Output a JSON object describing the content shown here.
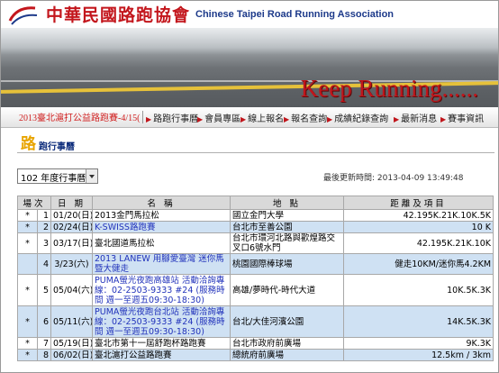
{
  "header": {
    "title_cn": "中華民國路跑協會",
    "title_en": "Chinese Taipei Road Running Association",
    "slogan": "Keep Running......",
    "colors": {
      "brand_red": "#c3161c",
      "brand_blue": "#1d3a8a"
    }
  },
  "nav": {
    "marquee": "2013臺北滬打公益路跑賽-4/15(",
    "items": [
      {
        "label": "路跑行事曆",
        "icon": "arrow-icon"
      },
      {
        "label": "會員專區",
        "icon": "arrow-icon"
      },
      {
        "label": "線上報名",
        "icon": "arrow-icon"
      },
      {
        "label": "報名查詢",
        "icon": "arrow-icon"
      },
      {
        "label": "成績紀錄查詢",
        "icon": "arrow-icon"
      },
      {
        "label": "最新消息",
        "icon": "arrow-icon"
      },
      {
        "label": "賽事資訊",
        "icon": "arrow-icon"
      }
    ]
  },
  "section": {
    "icon_char": "路",
    "title": "跑行事曆"
  },
  "year_select": {
    "value": "102 年度行事曆"
  },
  "updated": "最後更新時間: 2013-04-09 13:49:48",
  "table": {
    "headers": [
      "場次",
      "日 期",
      "名 稱",
      "地 點",
      "距離及項目"
    ],
    "rows": [
      {
        "mark": "*",
        "no": "1",
        "date": "01/20(日)",
        "name": "2013金門馬拉松",
        "place": "國立金門大學",
        "dist": "42.195K.21K.10K.5K",
        "shade": false,
        "link": false
      },
      {
        "mark": "*",
        "no": "2",
        "date": "02/24(日)",
        "name": "K-SWISS路跑賽",
        "place": "台北市至善公園",
        "dist": "10 K",
        "shade": true,
        "link": true
      },
      {
        "mark": "*",
        "no": "3",
        "date": "03/17(日)",
        "name": "臺北國道馬拉松",
        "place": "台北市環河北路與歡煌路交叉口6號水門",
        "dist": "42.195K.21K.10K",
        "shade": false,
        "link": false
      },
      {
        "mark": "",
        "no": "4",
        "date": "3/23(六)",
        "name": "2013 LANEW 用腳愛臺灣 迷你馬暨大健走",
        "place": "桃園國際棒球場",
        "dist": "健走10KM/迷你馬4.2KM",
        "shade": true,
        "link": true
      },
      {
        "mark": "*",
        "no": "5",
        "date": "05/04(六)",
        "name": "PUMA螢光夜跑高雄站 活動洽詢專線：02-2503-9333 #24 (服務時間 週一至週五09:30-18:30)",
        "place": "高雄/夢時代-時代大道",
        "dist": "10K.5K.3K",
        "shade": false,
        "link": true
      },
      {
        "mark": "*",
        "no": "6",
        "date": "05/11(六)",
        "name": "PUMA螢光夜跑台北站 活動洽詢專線：02-2503-9333 #24 (服務時間 週一至週五09:30-18:30)",
        "place": "台北/大佳河濱公園",
        "dist": "14K.5K.3K",
        "shade": true,
        "link": true
      },
      {
        "mark": "*",
        "no": "7",
        "date": "05/19(日)",
        "name": "臺北市第十一屆舒跑杯路跑賽",
        "place": "台北市政府前廣場",
        "dist": "9K.3K",
        "shade": false,
        "link": false
      },
      {
        "mark": "*",
        "no": "8",
        "date": "06/02(日)",
        "name": "臺北滬打公益路跑賽",
        "place": "總統府前廣場",
        "dist": "12.5km / 3km",
        "shade": true,
        "link": false
      }
    ]
  }
}
